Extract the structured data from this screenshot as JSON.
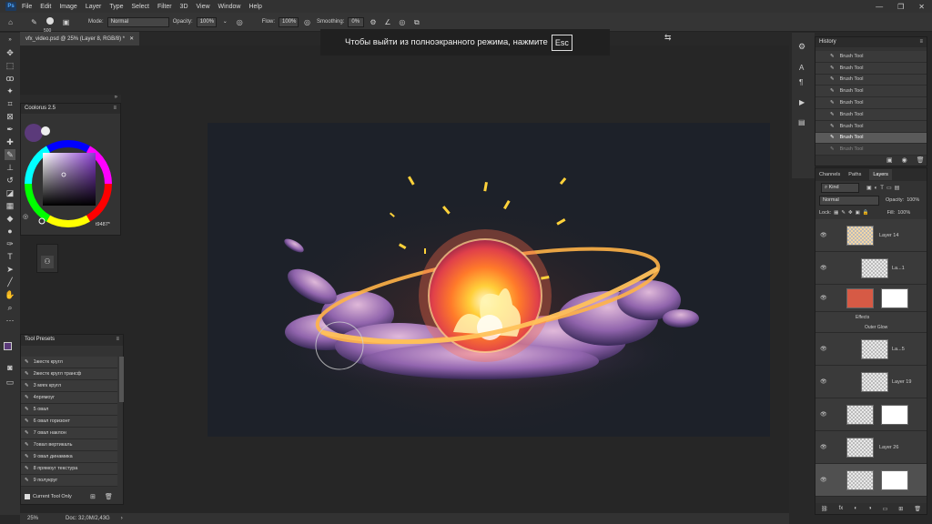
{
  "app": {
    "logo": "Ps"
  },
  "menu": [
    "File",
    "Edit",
    "Image",
    "Layer",
    "Type",
    "Select",
    "Filter",
    "3D",
    "View",
    "Window",
    "Help"
  ],
  "options": {
    "brush_size": "500",
    "mode_label": "Mode:",
    "mode_value": "Normal",
    "opacity_label": "Opacity:",
    "opacity_value": "100%",
    "flow_label": "Flow:",
    "flow_value": "100%",
    "smoothing_label": "Smoothing:",
    "smoothing_value": "0%"
  },
  "tab": {
    "title": "vfx_video.psd @ 25% (Layer 8, RGB/8) *"
  },
  "notice": {
    "text": "Чтобы выйти из полноэкранного режима, нажмите",
    "key": "Esc"
  },
  "coolorus": {
    "title": "Coolorus 2.5",
    "hex": "t9487*",
    "current_color": "#5b3a7a"
  },
  "tool_presets": {
    "title": "Tool Presets",
    "items": [
      "1жестк кругл",
      "2жестк кругл трансф",
      "3 мягк кругл",
      "4прямоуг",
      "5 овал",
      "6 овал горизонт",
      "7 овал наклон",
      "7овал вертикаль",
      "9 овал динамика",
      "8 прямоуг текстура",
      "9 полукруг"
    ],
    "current_only": "Current Tool Only"
  },
  "history": {
    "title": "History",
    "items": [
      "Brush Tool",
      "Brush Tool",
      "Brush Tool",
      "Brush Tool",
      "Brush Tool",
      "Brush Tool",
      "Brush Tool",
      "Brush Tool",
      "Brush Tool"
    ]
  },
  "layers": {
    "tabs": [
      "Channels",
      "Paths",
      "Layers"
    ],
    "kind": "Kind",
    "blend": "Normal",
    "opacity_label": "Opacity:",
    "opacity_value": "100%",
    "lock_label": "Lock:",
    "fill_label": "Fill:",
    "fill_value": "100%",
    "rows": [
      "Layer 14",
      "La...1",
      "",
      "Effects",
      "Outer Glow",
      "La...5",
      "Layer 19",
      "",
      "Layer 26",
      ""
    ]
  },
  "status": {
    "zoom": "25%",
    "doc": "Doc: 32,0M/2,43G"
  },
  "colors": {
    "accent": "#31a8ff",
    "glow": "#ffcc33",
    "layer_red": "#d65a45"
  }
}
